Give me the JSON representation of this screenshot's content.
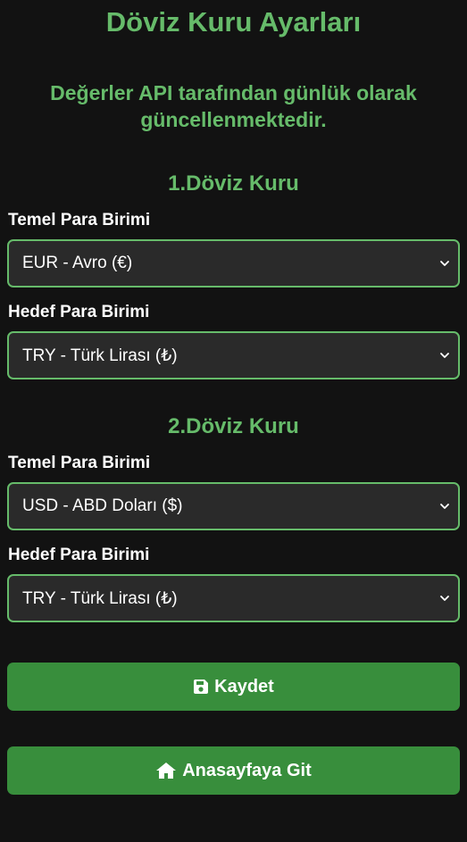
{
  "page": {
    "title": "Döviz Kuru Ayarları",
    "notice": "Değerler API tarafından günlük olarak güncellenmektedir."
  },
  "pairs": [
    {
      "heading": "1.Döviz Kuru",
      "base_label": "Temel Para Birimi",
      "base_value": "EUR - Avro (€)",
      "target_label": "Hedef Para Birimi",
      "target_value": "TRY - Türk Lirası (₺)"
    },
    {
      "heading": "2.Döviz Kuru",
      "base_label": "Temel Para Birimi",
      "base_value": "USD - ABD Doları ($)",
      "target_label": "Hedef Para Birimi",
      "target_value": "TRY - Türk Lirası (₺)"
    }
  ],
  "buttons": {
    "save_label": "Kaydet",
    "save_icon": "floppy-disk-icon",
    "home_label": "Anasayfaya Git",
    "home_icon": "home-icon"
  },
  "colors": {
    "background": "#121212",
    "accent": "#66bb6a",
    "button": "#388e3c",
    "select_bg": "#2a2a2a"
  }
}
